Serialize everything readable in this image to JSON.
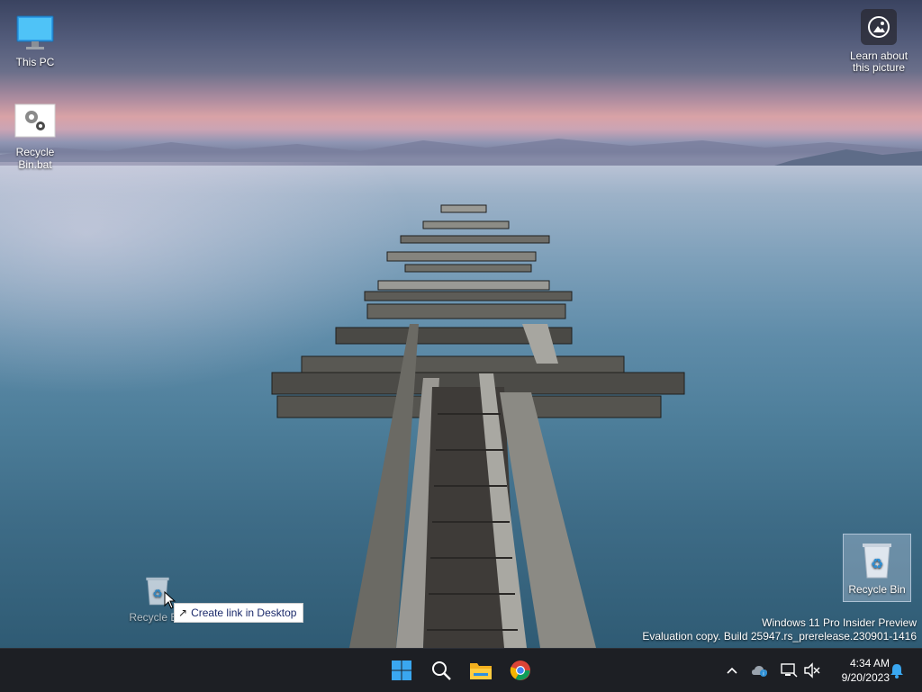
{
  "desktop": {
    "icons": [
      {
        "label": "This PC",
        "icon": "monitor-icon"
      },
      {
        "label": "Recycle Bin.bat",
        "icon": "gears-icon"
      },
      {
        "label": "Recycle Bin",
        "icon": "recycle-bin-icon"
      }
    ],
    "spotlight": {
      "label": "Learn about this picture",
      "icon": "camera-icon"
    },
    "drag": {
      "ghost_label": "Recycle Bin",
      "tooltip": "Create link in Desktop"
    },
    "watermark": {
      "line1": "Windows 11 Pro Insider Preview",
      "line2": "Evaluation copy. Build 25947.rs_prerelease.230901-1416"
    }
  },
  "taskbar": {
    "apps": [
      "start-icon",
      "search-icon",
      "file-explorer-icon",
      "chrome-icon"
    ],
    "tray": [
      "chevron-up-icon",
      "onedrive-icon",
      "network-icon",
      "volume-muted-icon"
    ],
    "clock": {
      "time": "4:34 AM",
      "date": "9/20/2023"
    },
    "notifications": "bell-icon"
  },
  "colors": {
    "taskbar_bg": "#1d1f24",
    "tooltip_text": "#1b2a6b",
    "start_blue": "#3aa7f0"
  }
}
